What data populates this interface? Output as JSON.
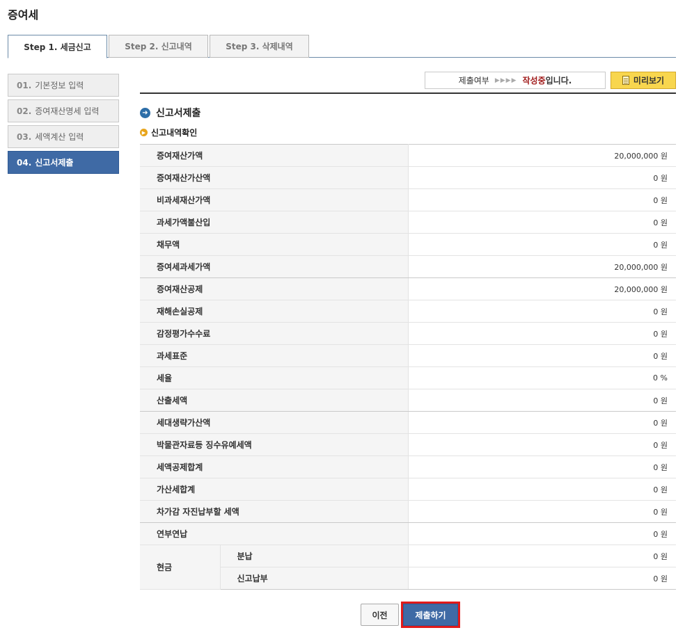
{
  "page": {
    "title": "증여세"
  },
  "tabs": [
    {
      "label": "Step 1. 세금신고",
      "active": true
    },
    {
      "label": "Step 2. 신고내역",
      "active": false
    },
    {
      "label": "Step 3. 삭제내역",
      "active": false
    }
  ],
  "sidebar": {
    "items": [
      {
        "num": "01.",
        "label": "기본정보 입력",
        "active": false
      },
      {
        "num": "02.",
        "label": "증여재산명세 입력",
        "active": false
      },
      {
        "num": "03.",
        "label": "세액계산 입력",
        "active": false
      },
      {
        "num": "04.",
        "label": "신고서제출",
        "active": true
      }
    ]
  },
  "status": {
    "label": "제출여부",
    "arrows": "▶▶▶▶",
    "state": "작성중",
    "suffix": "입니다."
  },
  "preview_button": {
    "label": "미리보기"
  },
  "section": {
    "title": "신고서제출",
    "subtitle": "신고내역확인"
  },
  "summary": {
    "rows": [
      {
        "label": "증여재산가액",
        "value": "20,000,000 원"
      },
      {
        "label": "증여재산가산액",
        "value": "0 원"
      },
      {
        "label": "비과세재산가액",
        "value": "0 원"
      },
      {
        "label": "과세가액불산입",
        "value": "0 원"
      },
      {
        "label": "채무액",
        "value": "0 원"
      },
      {
        "label": "증여세과세가액",
        "value": "20,000,000 원"
      },
      {
        "label": "증여재산공제",
        "value": "20,000,000 원"
      },
      {
        "label": "재해손실공제",
        "value": "0 원"
      },
      {
        "label": "감정평가수수료",
        "value": "0 원"
      },
      {
        "label": "과세표준",
        "value": "0 원"
      },
      {
        "label": "세율",
        "value": "0 %"
      },
      {
        "label": "산출세액",
        "value": "0 원"
      },
      {
        "label": "세대생략가산액",
        "value": "0 원"
      },
      {
        "label": "박물관자료등 징수유예세액",
        "value": "0 원"
      },
      {
        "label": "세액공제합계",
        "value": "0 원"
      },
      {
        "label": "가산세합계",
        "value": "0 원"
      },
      {
        "label": "차가감 자진납부할 세액",
        "value": "0 원"
      },
      {
        "label": "연부연납",
        "value": "0 원"
      }
    ],
    "cash": {
      "label": "현금",
      "rows": [
        {
          "label": "분납",
          "value": "0 원"
        },
        {
          "label": "신고납부",
          "value": "0 원"
        }
      ]
    }
  },
  "buttons": {
    "prev": "이전",
    "submit": "제출하기"
  },
  "colors": {
    "accent_blue": "#3f6aa5",
    "highlight_red": "#e11a1a",
    "status_red": "#a01a1a",
    "preview_yellow": "#f8d64e"
  }
}
